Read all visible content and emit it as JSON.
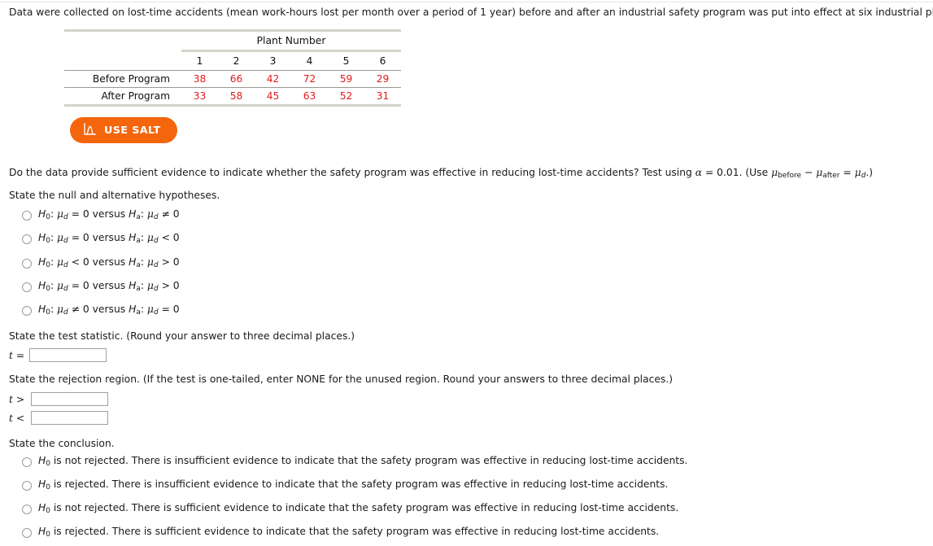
{
  "intro": {
    "text": "Data were collected on lost-time accidents (mean work-hours lost per month over a period of 1 year) before and after an industrial safety program was put into effect at six industrial plants."
  },
  "table": {
    "group_header": "Plant Number",
    "columns": [
      "1",
      "2",
      "3",
      "4",
      "5",
      "6"
    ],
    "rows": [
      {
        "label": "Before Program",
        "values": [
          "38",
          "66",
          "42",
          "72",
          "59",
          "29"
        ]
      },
      {
        "label": "After Program",
        "values": [
          "33",
          "58",
          "45",
          "63",
          "52",
          "31"
        ]
      }
    ],
    "value_color": "#e01b1b",
    "rule_color": "#d3d3ca"
  },
  "salt_button": {
    "label": "USE SALT",
    "icon": "distribution-curve-icon",
    "bg_color": "#f4650c",
    "text_color": "#ffffff"
  },
  "question": {
    "prompt_part1": "Do the data provide sufficient evidence to indicate whether the safety program was effective in reducing lost-time accidents? Test using ",
    "alpha_symbol": "α",
    "prompt_part2": " = 0.01. (Use ",
    "mu_symbol": "μ",
    "sub_before": "before",
    "minus_symbol": "−",
    "sub_after": "after",
    "sub_d": "d",
    "prompt_part3": ".)"
  },
  "sections": {
    "hypotheses_label": "State the null and alternative hypotheses.",
    "test_statistic_label": "State the test statistic. (Round your answer to three decimal places.)",
    "rejection_region_label": "State the rejection region. (If the test is one-tailed, enter NONE for the unused region. Round your answers to three decimal places.)",
    "conclusion_label": "State the conclusion."
  },
  "hypothesis_options": [
    {
      "h0_sym": "H",
      "h0_sub": "0",
      "h0_mu": "μ",
      "h0_mu_sub": "d",
      "h0_rel": "= 0",
      "versus": "versus",
      "ha_sym": "H",
      "ha_sub": "a",
      "ha_mu": "μ",
      "ha_mu_sub": "d",
      "ha_rel": "≠ 0",
      "selected": false
    },
    {
      "h0_sym": "H",
      "h0_sub": "0",
      "h0_mu": "μ",
      "h0_mu_sub": "d",
      "h0_rel": "= 0",
      "versus": "versus",
      "ha_sym": "H",
      "ha_sub": "a",
      "ha_mu": "μ",
      "ha_mu_sub": "d",
      "ha_rel": "< 0",
      "selected": false
    },
    {
      "h0_sym": "H",
      "h0_sub": "0",
      "h0_mu": "μ",
      "h0_mu_sub": "d",
      "h0_rel": "< 0",
      "versus": "versus",
      "ha_sym": "H",
      "ha_sub": "a",
      "ha_mu": "μ",
      "ha_mu_sub": "d",
      "ha_rel": "> 0",
      "selected": false
    },
    {
      "h0_sym": "H",
      "h0_sub": "0",
      "h0_mu": "μ",
      "h0_mu_sub": "d",
      "h0_rel": "= 0",
      "versus": "versus",
      "ha_sym": "H",
      "ha_sub": "a",
      "ha_mu": "μ",
      "ha_mu_sub": "d",
      "ha_rel": "> 0",
      "selected": false
    },
    {
      "h0_sym": "H",
      "h0_sub": "0",
      "h0_mu": "μ",
      "h0_mu_sub": "d",
      "h0_rel": "≠ 0",
      "versus": "versus",
      "ha_sym": "H",
      "ha_sub": "a",
      "ha_mu": "μ",
      "ha_mu_sub": "d",
      "ha_rel": "= 0",
      "selected": false
    }
  ],
  "answers": {
    "t_label": "t",
    "t_equals": "=",
    "t_value": "",
    "t_placeholder": "",
    "gt_label": "t",
    "gt_op": ">",
    "gt_value": "",
    "lt_label": "t",
    "lt_op": "<",
    "lt_value": ""
  },
  "conclusion_options": [
    {
      "sym": "H",
      "sub": "0",
      "text": " is not rejected. There is insufficient evidence to indicate that the safety program was effective in reducing lost-time accidents.",
      "selected": false
    },
    {
      "sym": "H",
      "sub": "0",
      "text": " is rejected. There is insufficient evidence to indicate that the safety program was effective in reducing lost-time accidents.",
      "selected": false
    },
    {
      "sym": "H",
      "sub": "0",
      "text": " is not rejected. There is sufficient evidence to indicate that the safety program was effective in reducing lost-time accidents.",
      "selected": false
    },
    {
      "sym": "H",
      "sub": "0",
      "text": " is rejected. There is sufficient evidence to indicate that the safety program was effective in reducing lost-time accidents.",
      "selected": false
    }
  ]
}
